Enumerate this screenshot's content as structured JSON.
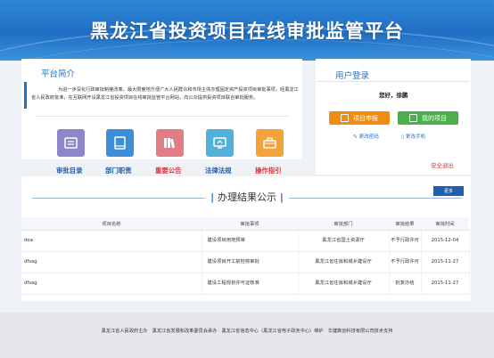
{
  "site_title": "黑龙江省投资项目在线审批监管平台",
  "intro": {
    "title": "平台简介",
    "text": "为进一步深化行政审批制度改革，最大限度地方便广大人民群众和市场主体办理固定资产投资项目审批事项，经黑龙江省人民政府批准，在互联网开设黑龙江省投资项目在线审批监管平台网站，向公众提供投资项目联合审批服务。"
  },
  "nav_tiles": [
    {
      "label": "审批目录",
      "icon": "catalog-icon",
      "color": "#8d86c9",
      "label_color": "#1f5fae"
    },
    {
      "label": "部门职责",
      "icon": "book-icon",
      "color": "#3d8ed8",
      "label_color": "#1f5fae"
    },
    {
      "label": "重要公告",
      "icon": "books-icon",
      "color": "#e07d85",
      "label_color": "#d9363e"
    },
    {
      "label": "法律法规",
      "icon": "monitor-icon",
      "color": "#52b0da",
      "label_color": "#1f5fae"
    },
    {
      "label": "操作指引",
      "icon": "toolbox-icon",
      "color": "#f4a33a",
      "label_color": "#d9363e"
    }
  ],
  "user": {
    "title": "用户登录",
    "greeting": "您好，徐鹏",
    "apply_label": "项目申报",
    "mine_label": "我的项目",
    "change_password": "更改密码",
    "change_phone": "更改手机",
    "logout": "安全退出"
  },
  "results": {
    "title": "办理结果公示",
    "more": "更多",
    "columns": [
      "项目名称",
      "审批事项",
      "审批部门",
      "审批结果",
      "审批时间"
    ],
    "rows": [
      {
        "name": "dea",
        "item": "建设项目用地预审",
        "dept": "黑龙江省国土资源厅",
        "result": "不予行政许可",
        "date": "2015-12-04"
      },
      {
        "name": "dfsag",
        "item": "建设项目开工前检核审批",
        "dept": "黑龙江省住房和城乡建设厅",
        "result": "不予行政许可",
        "date": "2015-11-27"
      },
      {
        "name": "dfsag",
        "item": "建设工程规划许可证核准",
        "dept": "黑龙江省住房和城乡建设厅",
        "result": "批复办结",
        "date": "2015-11-27"
      }
    ]
  },
  "footer": "黑龙江省人民政府主办　黑龙江省发展和改革委员会承办　黑龙江省信息中心（黑龙江省电子政务中心）维护　华建数创科技有限公司技术支持",
  "colors": {
    "brand_blue": "#1f6fc4",
    "orange": "#f08c12",
    "green": "#4cae4c",
    "red": "#d9363e"
  }
}
